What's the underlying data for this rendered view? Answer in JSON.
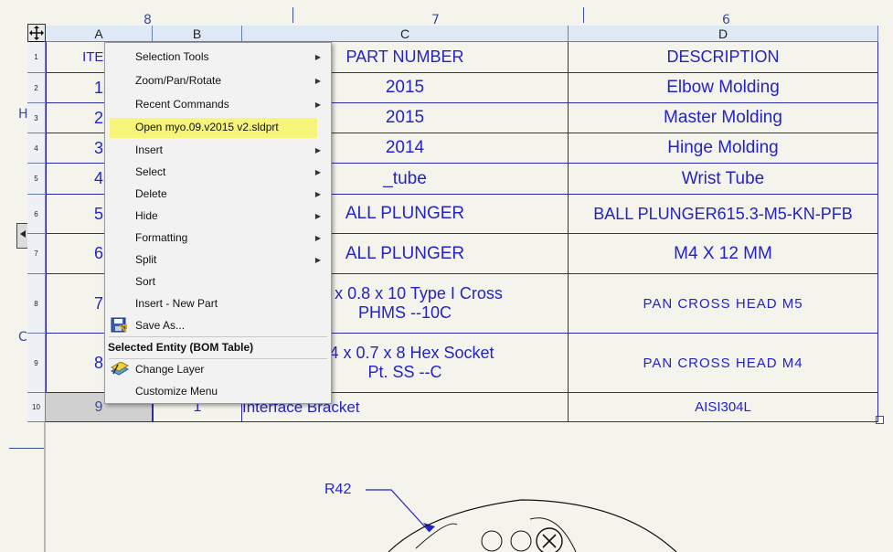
{
  "bom": {
    "col_headers": [
      "A",
      "B",
      "C",
      "D"
    ],
    "row_headers": [
      "1",
      "2",
      "3",
      "4",
      "5",
      "6",
      "7",
      "8",
      "9",
      "10"
    ],
    "header_row": {
      "item": "ITEM",
      "part_number": "PART NUMBER",
      "description": "DESCRIPTION"
    },
    "rows": [
      {
        "item": "1",
        "part": "2015",
        "desc": "Elbow Molding"
      },
      {
        "item": "2",
        "part": "2015",
        "desc": "Master Molding"
      },
      {
        "item": "3",
        "part": "2014",
        "desc": "Hinge Molding"
      },
      {
        "item": "4",
        "part": "_tube",
        "desc": "Wrist Tube"
      },
      {
        "item": "5",
        "part": "ALL PLUNGER",
        "desc": "BALL PLUNGER615.3-M5-KN-PFB"
      },
      {
        "item": "6",
        "part": "ALL PLUNGER",
        "desc": "M4 X 12 MM"
      },
      {
        "item": "7",
        "part": "M5 x 0.8 x 10 Type I Cross",
        "part2": "PHMS --10C",
        "desc": "PAN CROSS HEAD M5"
      },
      {
        "item": "8",
        "part": "M4 x 0.7 x 8 Hex Socket",
        "part2": "Pt. SS --C",
        "desc": "PAN CROSS HEAD M4"
      },
      {
        "item": "9",
        "qty": "1",
        "part": "Interface Bracket",
        "desc": "AISI304L"
      }
    ]
  },
  "context_menu": {
    "items": [
      {
        "label": "Selection Tools",
        "submenu": true
      },
      {
        "label": "Zoom/Pan/Rotate",
        "submenu": true
      },
      {
        "label": "Recent Commands",
        "submenu": true
      },
      {
        "label": "Open myo.09.v2015 v2.sldprt",
        "highlight": true
      },
      {
        "label": "Insert",
        "submenu": true
      },
      {
        "label": "Select",
        "submenu": true
      },
      {
        "label": "Delete",
        "submenu": true
      },
      {
        "label": "Hide",
        "submenu": true
      },
      {
        "label": "Formatting",
        "submenu": true
      },
      {
        "label": "Split",
        "submenu": true
      },
      {
        "label": "Sort"
      },
      {
        "label": "Insert - New Part"
      },
      {
        "label": "Save As...",
        "icon": "save-as-icon"
      }
    ],
    "section_title": "Selected Entity (BOM Table)",
    "section_items": [
      {
        "label": "Change Layer",
        "icon": "change-layer-icon"
      },
      {
        "label": "Customize Menu"
      }
    ]
  },
  "drawing": {
    "zone_numbers": [
      "8",
      "7",
      "6"
    ],
    "zone_letters": [
      "H",
      "C"
    ],
    "dimension": "R42"
  },
  "colors": {
    "table_text": "#2323c8",
    "table_lines": "#2a2aa8",
    "highlight": "#f6f57a",
    "header_bg": "#dfe9f5"
  }
}
